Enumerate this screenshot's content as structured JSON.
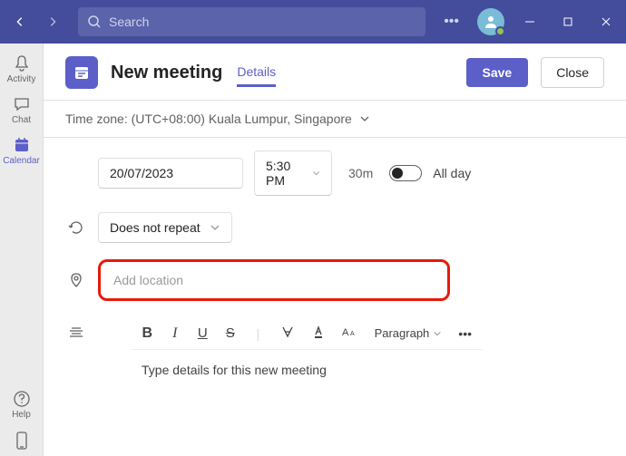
{
  "titlebar": {
    "search_placeholder": "Search"
  },
  "sidebar": {
    "activity": "Activity",
    "chat": "Chat",
    "calendar": "Calendar",
    "help": "Help"
  },
  "header": {
    "title": "New meeting",
    "tab_details": "Details",
    "save": "Save",
    "close": "Close"
  },
  "timezone": {
    "text": "Time zone: (UTC+08:00) Kuala Lumpur, Singapore"
  },
  "form": {
    "date": "20/07/2023",
    "time": "5:30 PM",
    "duration": "30m",
    "allday": "All day",
    "repeat": "Does not repeat",
    "location_placeholder": "Add location"
  },
  "editor": {
    "paragraph": "Paragraph",
    "placeholder": "Type details for this new meeting"
  }
}
